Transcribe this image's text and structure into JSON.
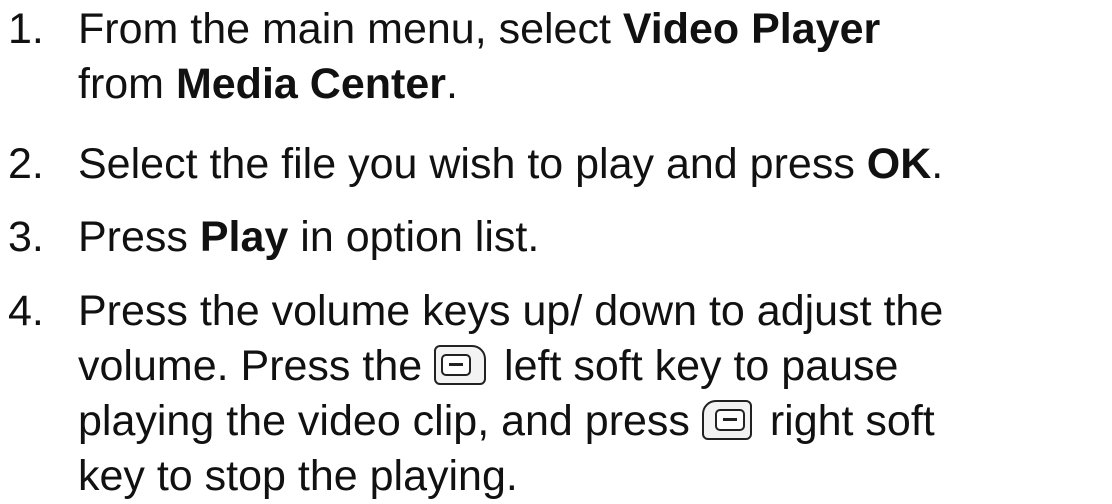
{
  "steps": [
    {
      "number": "1.",
      "line1": {
        "t1": "From the main menu, select ",
        "b1": "Video Player"
      },
      "line2": {
        "t1": "from ",
        "b1": "Media Center",
        "t2": "."
      }
    },
    {
      "number": "2.",
      "line1": {
        "t1": "Select the file you wish to play and press ",
        "b1": "OK",
        "t2": "."
      }
    },
    {
      "number": "3.",
      "line1": {
        "t1": "Press ",
        "b1": "Play",
        "t2": " in option list."
      }
    },
    {
      "number": "4.",
      "line1": {
        "t1": "Press the volume keys up/ down to adjust the"
      },
      "line2": {
        "t1": "volume. Press the ",
        "icon": "left-soft-key-icon",
        "t2": " left soft key to pause"
      },
      "line3": {
        "t1": "playing the video clip, and press ",
        "icon": "right-soft-key-icon",
        "t2": " right soft"
      },
      "line4": {
        "t1": "key to stop the playing."
      }
    }
  ]
}
